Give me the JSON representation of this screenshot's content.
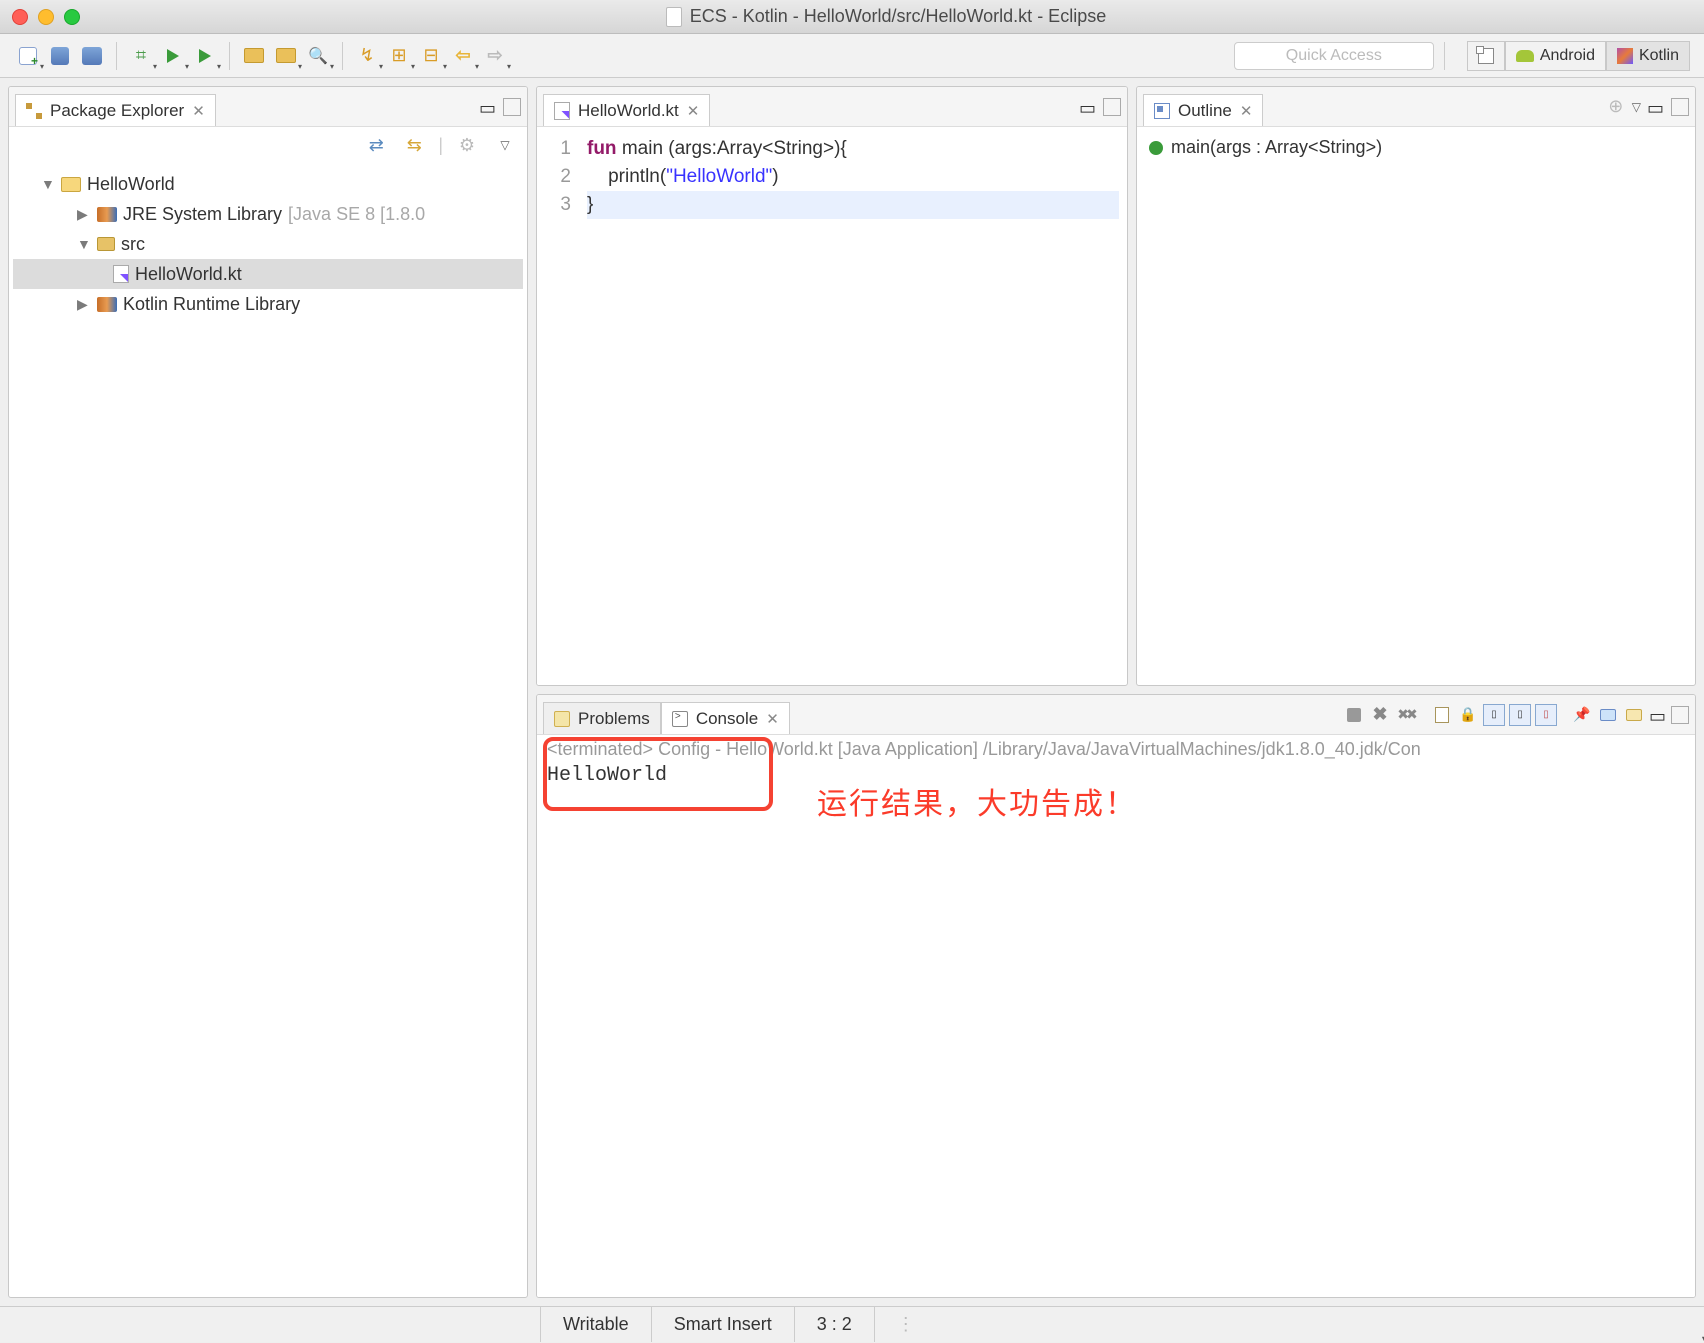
{
  "window": {
    "title": "ECS - Kotlin - HelloWorld/src/HelloWorld.kt - Eclipse"
  },
  "toolbar": {
    "quick_access_placeholder": "Quick Access",
    "perspectives": {
      "android": "Android",
      "kotlin": "Kotlin"
    }
  },
  "explorer": {
    "title": "Package Explorer",
    "tree": {
      "project": "HelloWorld",
      "jre_label": "JRE System Library",
      "jre_suffix": "[Java SE 8 [1.8.0",
      "src": "src",
      "file": "HelloWorld.kt",
      "kotlin_lib": "Kotlin Runtime Library"
    }
  },
  "editor": {
    "tab_label": "HelloWorld.kt",
    "lines": {
      "n1": "1",
      "n2": "2",
      "n3": "3"
    },
    "code": {
      "kw_fun": "fun",
      "main": " main (args:Array<String>){",
      "println_pre": "    println(",
      "string": "\"HelloWorld\"",
      "println_post": ")",
      "close": "}"
    }
  },
  "outline": {
    "title": "Outline",
    "item": "main(args : Array<String>)"
  },
  "bottom": {
    "problems_tab": "Problems",
    "console_tab": "Console",
    "console_meta": "<terminated> Config - HelloWorld.kt [Java Application] /Library/Java/JavaVirtualMachines/jdk1.8.0_40.jdk/Con",
    "console_output": "HelloWorld",
    "annotation": "运行结果，大功告成！"
  },
  "statusbar": {
    "writable": "Writable",
    "insert_mode": "Smart Insert",
    "cursor_pos": "3 : 2"
  }
}
